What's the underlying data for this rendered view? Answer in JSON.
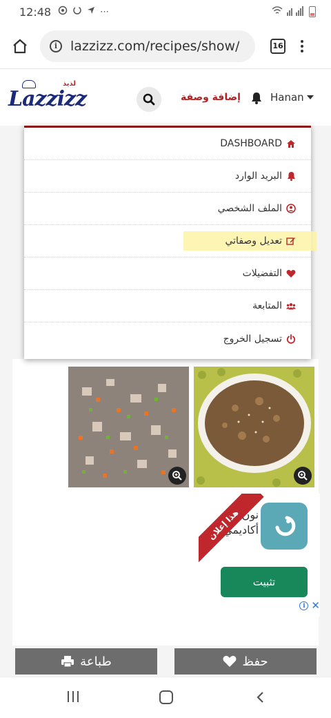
{
  "status_bar": {
    "time": "12:48",
    "icons": [
      "whatsapp-icon",
      "sync-icon",
      "location-icon",
      "more-icon",
      "wifi-icon",
      "signal-icon",
      "battery-icon"
    ]
  },
  "browser": {
    "url": "lazzizz.com/recipes/show/",
    "tab_count": "16"
  },
  "header": {
    "logo_text": "Lazzizz",
    "logo_arabic": "لذيذ",
    "add_recipe": "إضافة وصفة",
    "username": "Hanan"
  },
  "dropdown": {
    "items": [
      {
        "label": "DASHBOARD",
        "icon": "home-icon"
      },
      {
        "label": "البريد الوارد",
        "icon": "bell-icon"
      },
      {
        "label": "الملف الشخصي",
        "icon": "user-circle-icon"
      },
      {
        "label": "تعديل وصفاتي",
        "icon": "edit-icon",
        "highlighted": true
      },
      {
        "label": "التفضيلات",
        "icon": "heart-icon"
      },
      {
        "label": "المتابعة",
        "icon": "users-icon"
      },
      {
        "label": "تسجيل الخروج",
        "icon": "power-icon"
      }
    ]
  },
  "ad": {
    "ribbon": "هذا إعلان",
    "title_line1": "نون",
    "title_line2": "أكاديمي",
    "install": "تثبيت"
  },
  "actions": {
    "print": "طباعة",
    "save": "حفظ"
  },
  "colors": {
    "brand_red": "#b22222",
    "dropdown_border": "#8b1a1a",
    "install_green": "#18875a",
    "button_gray": "#6d6d6d",
    "highlight_yellow": "#fbf3a6"
  }
}
